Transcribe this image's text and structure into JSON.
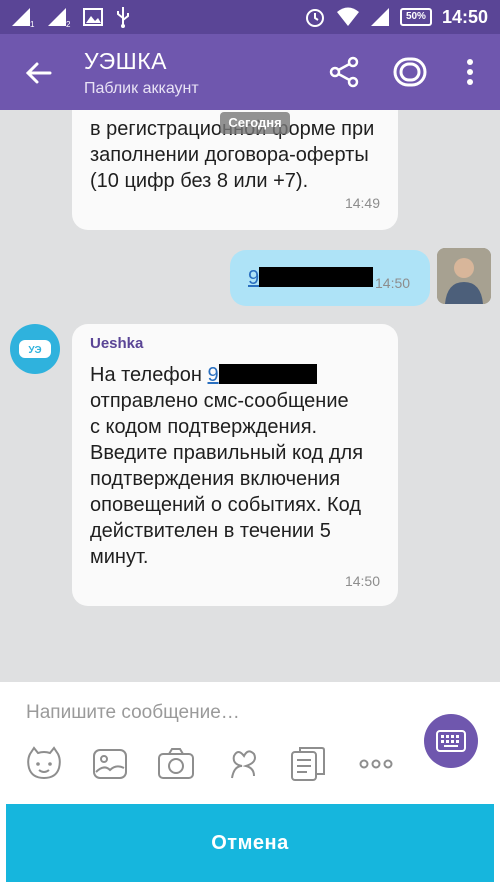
{
  "status_bar": {
    "sim1": "1",
    "sim2": "2",
    "battery": "50%",
    "time": "14:50"
  },
  "header": {
    "title": "УЭШКА",
    "subtitle": "Паблик аккаунт"
  },
  "chat": {
    "date_separator": "Сегодня",
    "messages": [
      {
        "line1": "в регистрационной форме при",
        "line2": "заполнении договора-оферты",
        "line3": "(10 цифр без 8 или +7).",
        "time": "14:49"
      },
      {
        "phone_prefix": "9",
        "time": "14:50"
      },
      {
        "sender": "Ueshka",
        "text_prefix": "На телефон ",
        "phone_prefix": "9",
        "line2": "отправлено смс-сообщение",
        "line3": "с кодом подтверждения.",
        "line4": "Введите правильный код для",
        "line5": "подтверждения включения",
        "line6": "оповещений о событиях. Код",
        "line7": "действителен в течении 5",
        "line8": "минут.",
        "time": "14:50"
      }
    ]
  },
  "compose": {
    "placeholder": "Напишите сообщение…",
    "cancel_label": "Отмена"
  },
  "colors": {
    "appbar": "#6f57ae",
    "statusbar": "#5a4596",
    "outgoing_bubble": "#aee3f7",
    "cancel": "#16b6dd"
  },
  "icons": [
    "back-arrow-icon",
    "share-icon",
    "public-account-icon",
    "more-vert-icon",
    "keyboard-icon",
    "sticker-icon",
    "gallery-icon",
    "camera-icon",
    "doodle-icon",
    "gif-icon",
    "more-horiz-icon"
  ]
}
